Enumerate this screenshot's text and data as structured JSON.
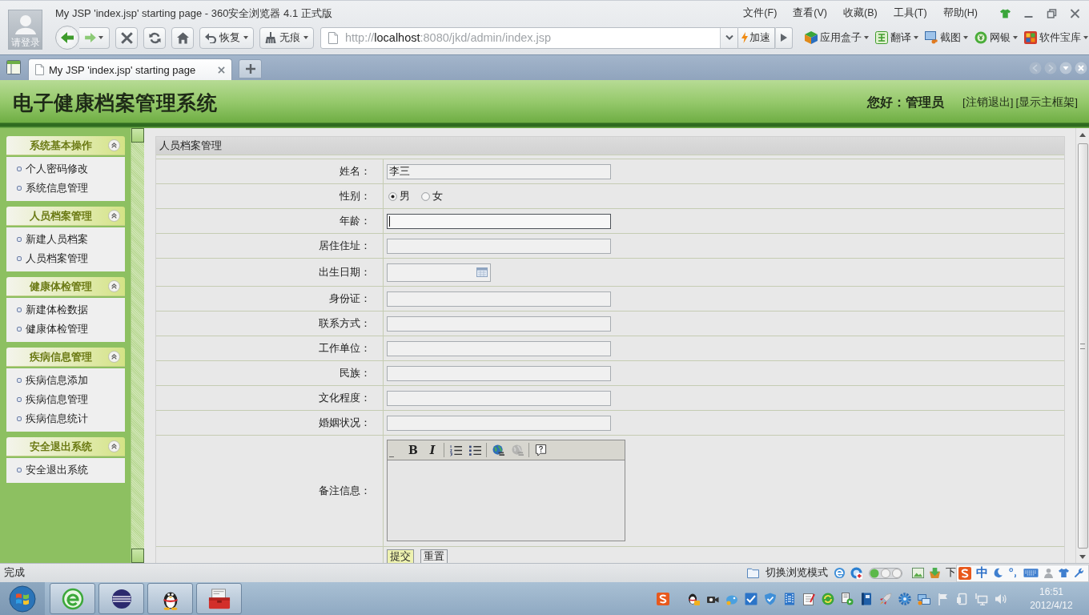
{
  "browser": {
    "title": "My JSP 'index.jsp' starting page - 360安全浏览器 4.1 正式版",
    "login_label": "请登录",
    "menu": [
      "文件(F)",
      "查看(V)",
      "收藏(B)",
      "工具(T)",
      "帮助(H)"
    ],
    "toolbar_buttons": [
      {
        "kind": "restore",
        "label": "恢复"
      },
      {
        "kind": "incognito",
        "label": "无痕"
      }
    ],
    "address": {
      "scheme": "http://",
      "host": "localhost",
      "path": ":8080/jkd/admin/index.jsp"
    },
    "speed_button": "加速",
    "extensions": [
      {
        "kind": "apps",
        "label": "应用盒子"
      },
      {
        "kind": "translate",
        "label": "翻译"
      },
      {
        "kind": "screenshot",
        "label": "截图"
      },
      {
        "kind": "bank",
        "label": "网银"
      },
      {
        "kind": "store",
        "label": "软件宝库"
      }
    ],
    "tabs": [
      {
        "label": "My JSP 'index.jsp' starting page",
        "selected": true
      }
    ]
  },
  "page": {
    "system_title": "电子健康档案管理系统",
    "greeting": "您好：管理员",
    "header_links": [
      "[注销退出]",
      "[显示主框架]"
    ],
    "sidebar": [
      {
        "title": "系统基本操作",
        "expanded": true,
        "items": [
          "个人密码修改",
          "系统信息管理"
        ]
      },
      {
        "title": "人员档案管理",
        "expanded": true,
        "items": [
          "新建人员档案",
          "人员档案管理"
        ]
      },
      {
        "title": "健康体检管理",
        "expanded": true,
        "items": [
          "新建体检数据",
          "健康体检管理"
        ]
      },
      {
        "title": "疾病信息管理",
        "expanded": true,
        "items": [
          "疾病信息添加",
          "疾病信息管理",
          "疾病信息统计"
        ]
      },
      {
        "title": "安全退出系统",
        "expanded": true,
        "items": [
          "安全退出系统"
        ]
      }
    ],
    "form": {
      "title": "人员档案管理",
      "fields": [
        {
          "label": "姓名：",
          "kind": "text",
          "value": "李三",
          "focused": false
        },
        {
          "label": "性别：",
          "kind": "radio",
          "focused": false,
          "options": [
            {
              "label": "男",
              "selected": true
            },
            {
              "label": "女",
              "selected": false
            }
          ]
        },
        {
          "label": "年龄：",
          "kind": "text",
          "focused": true
        },
        {
          "label": "居住住址：",
          "kind": "text",
          "focused": false
        },
        {
          "label": "出生日期：",
          "kind": "date",
          "focused": false
        },
        {
          "label": "身份证：",
          "kind": "text",
          "focused": false
        },
        {
          "label": "联系方式：",
          "kind": "text",
          "focused": false
        },
        {
          "label": "工作单位：",
          "kind": "text",
          "focused": false
        },
        {
          "label": "民族：",
          "kind": "text",
          "focused": false
        },
        {
          "label": "文化程度：",
          "kind": "text",
          "focused": false
        },
        {
          "label": "婚姻状况：",
          "kind": "text",
          "focused": false
        },
        {
          "label": "备注信息：",
          "kind": "editor",
          "focused": false,
          "tools": [
            {
              "kind": "bold",
              "label": "B",
              "disabled": false
            },
            {
              "kind": "italic",
              "label": "I",
              "disabled": false
            },
            {
              "kind": "ordered-list",
              "disabled": false
            },
            {
              "kind": "bullet-list",
              "disabled": false
            },
            {
              "kind": "link",
              "disabled": false
            },
            {
              "kind": "unlink",
              "disabled": true
            },
            {
              "kind": "help",
              "disabled": false
            }
          ]
        }
      ],
      "buttons": [
        {
          "label": "提交",
          "highlighted": true
        },
        {
          "label": "重置",
          "highlighted": false
        }
      ]
    }
  },
  "status_bar": {
    "text": "完成",
    "mode_button": "切换浏览模式",
    "cut_text": "下",
    "ime_mode": "中"
  },
  "taskbar": {
    "time": "16:51",
    "date": "2012/4/12"
  }
}
